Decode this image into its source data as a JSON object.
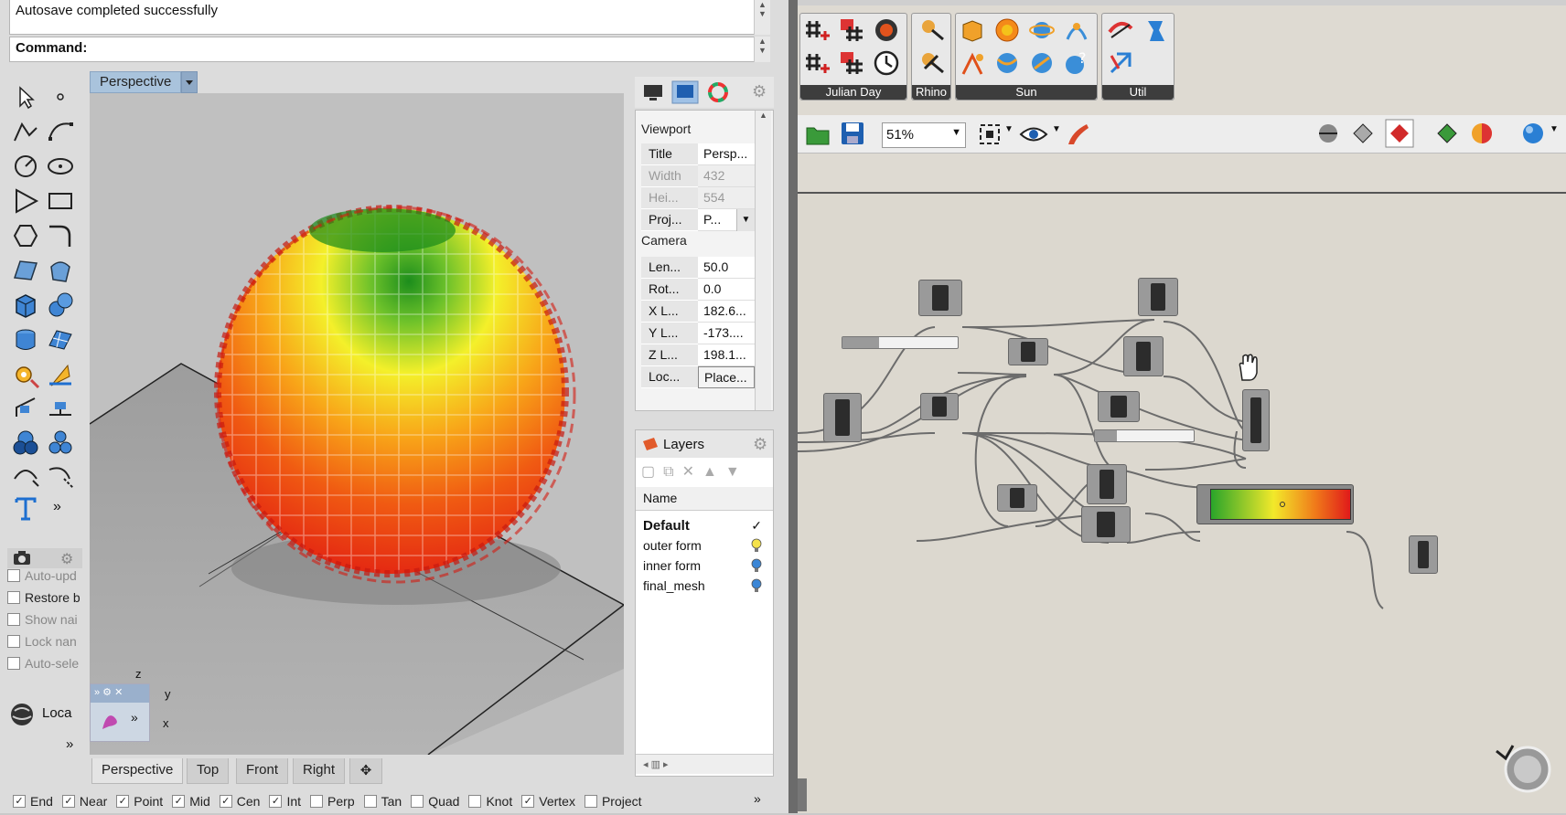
{
  "rhino": {
    "history_line": "Autosave completed successfully",
    "command_label": "Command:",
    "viewport_title": "Perspective",
    "bottom_tabs": [
      "Perspective",
      "Top",
      "Front",
      "Right"
    ],
    "snaps": [
      {
        "label": "End",
        "checked": true
      },
      {
        "label": "Near",
        "checked": true
      },
      {
        "label": "Point",
        "checked": true
      },
      {
        "label": "Mid",
        "checked": true
      },
      {
        "label": "Cen",
        "checked": true
      },
      {
        "label": "Int",
        "checked": true
      },
      {
        "label": "Perp",
        "checked": false
      },
      {
        "label": "Tan",
        "checked": false
      },
      {
        "label": "Quad",
        "checked": false
      },
      {
        "label": "Knot",
        "checked": false
      },
      {
        "label": "Vertex",
        "checked": true
      },
      {
        "label": "Project",
        "checked": false
      }
    ],
    "named_view_opts": [
      {
        "label": "Auto-upd",
        "checked": false
      },
      {
        "label": "Restore b",
        "checked": false
      },
      {
        "label": "Show nai",
        "checked": false
      },
      {
        "label": "Lock nan",
        "checked": false
      },
      {
        "label": "Auto-sele",
        "checked": false
      }
    ],
    "loca_label": "Loca",
    "properties": {
      "section_viewport": "Viewport",
      "section_camera": "Camera",
      "rows_viewport": [
        {
          "label": "Title",
          "value": "Persp..."
        },
        {
          "label": "Width",
          "value": "432"
        },
        {
          "label": "Hei...",
          "value": "554"
        },
        {
          "label": "Proj...",
          "value": "P..."
        }
      ],
      "rows_camera": [
        {
          "label": "Len...",
          "value": "50.0"
        },
        {
          "label": "Rot...",
          "value": "0.0"
        },
        {
          "label": "X L...",
          "value": "182.6..."
        },
        {
          "label": "Y L...",
          "value": "-173...."
        },
        {
          "label": "Z L...",
          "value": "198.1..."
        },
        {
          "label": "Loc...",
          "value": "Place..."
        }
      ]
    },
    "layers": {
      "title": "Layers",
      "header": "Name",
      "items": [
        {
          "name": "Default",
          "current": true
        },
        {
          "name": "outer form",
          "current": false,
          "bulb": "#f5e24a"
        },
        {
          "name": "inner form",
          "current": false,
          "bulb": "#3b86d6"
        },
        {
          "name": "final_mesh",
          "current": false,
          "bulb": "#3b86d6"
        }
      ]
    },
    "axis_labels": {
      "z": "z",
      "y": "y",
      "x": "x"
    }
  },
  "grasshopper": {
    "ribbon_groups": [
      "Julian Day",
      "Rhino",
      "Sun",
      "Util"
    ],
    "zoom": "51%"
  }
}
